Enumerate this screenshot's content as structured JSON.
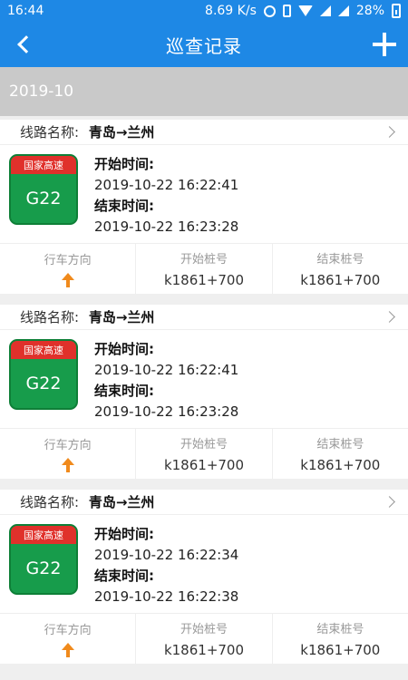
{
  "status_bar": {
    "time": "16:44",
    "network_speed": "8.69 K/s",
    "battery": "28%"
  },
  "appbar": {
    "title": "巡查记录"
  },
  "month_header": "2019-10",
  "labels": {
    "route": "线路名称:",
    "start_time": "开始时间:",
    "end_time": "结束时间:",
    "direction": "行车方向",
    "start_stake": "开始桩号",
    "end_stake": "结束桩号"
  },
  "records": [
    {
      "route": "青岛→兰州",
      "badge_top": "国家高速",
      "badge_code": "G22",
      "start": "2019-10-22 16:22:41",
      "end": "2019-10-22 16:23:28",
      "start_stake": "k1861+700",
      "end_stake": "k1861+700"
    },
    {
      "route": "青岛→兰州",
      "badge_top": "国家高速",
      "badge_code": "G22",
      "start": "2019-10-22 16:22:41",
      "end": "2019-10-22 16:23:28",
      "start_stake": "k1861+700",
      "end_stake": "k1861+700"
    },
    {
      "route": "青岛→兰州",
      "badge_top": "国家高速",
      "badge_code": "G22",
      "start": "2019-10-22 16:22:34",
      "end": "2019-10-22 16:22:38",
      "start_stake": "k1861+700",
      "end_stake": "k1861+700"
    }
  ],
  "colors": {
    "primary": "#1e88e5",
    "badge_red": "#e0312b",
    "badge_green": "#179c4b",
    "arrow_orange": "#f08a1c"
  }
}
